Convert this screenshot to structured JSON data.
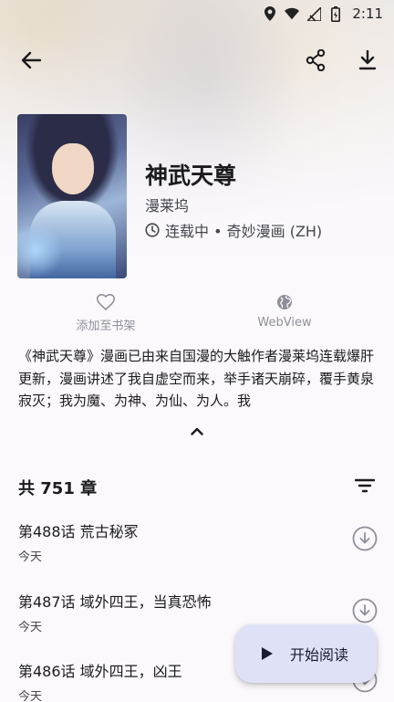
{
  "status_bar": {
    "time": "2:11",
    "icons": [
      "location-icon",
      "wifi-icon",
      "signal-icon",
      "battery-icon"
    ]
  },
  "top_bar": {
    "icons": [
      "back-arrow-icon",
      "share-icon",
      "download-icon"
    ]
  },
  "manga": {
    "title": "神武天尊",
    "author": "漫莱坞",
    "status_source": "连载中 • 奇妙漫画 (ZH)",
    "description": "《神武天尊》漫画已由来自国漫的大触作者漫莱坞连载爆肝更新，漫画讲述了我自虚空而来，举手诸天崩碎，覆手黄泉寂灭；我为魔、为神、为仙、为人。我"
  },
  "actions": {
    "add_to_library": "添加至书架",
    "webview": "WebView"
  },
  "chapters": {
    "count_label": "共 751 章",
    "items": [
      {
        "title": "第488话 荒古秘冢",
        "date": "今天"
      },
      {
        "title": "第487话 域外四王，当真恐怖",
        "date": "今天"
      },
      {
        "title": "第486话 域外四王，凶王",
        "date": "今天"
      }
    ]
  },
  "fab": {
    "label": "开始阅读"
  },
  "colors": {
    "background": "#fbf9fc",
    "fab_background": "#dfe2f7",
    "muted_text": "#8e8f99",
    "secondary_text": "#45464f"
  }
}
